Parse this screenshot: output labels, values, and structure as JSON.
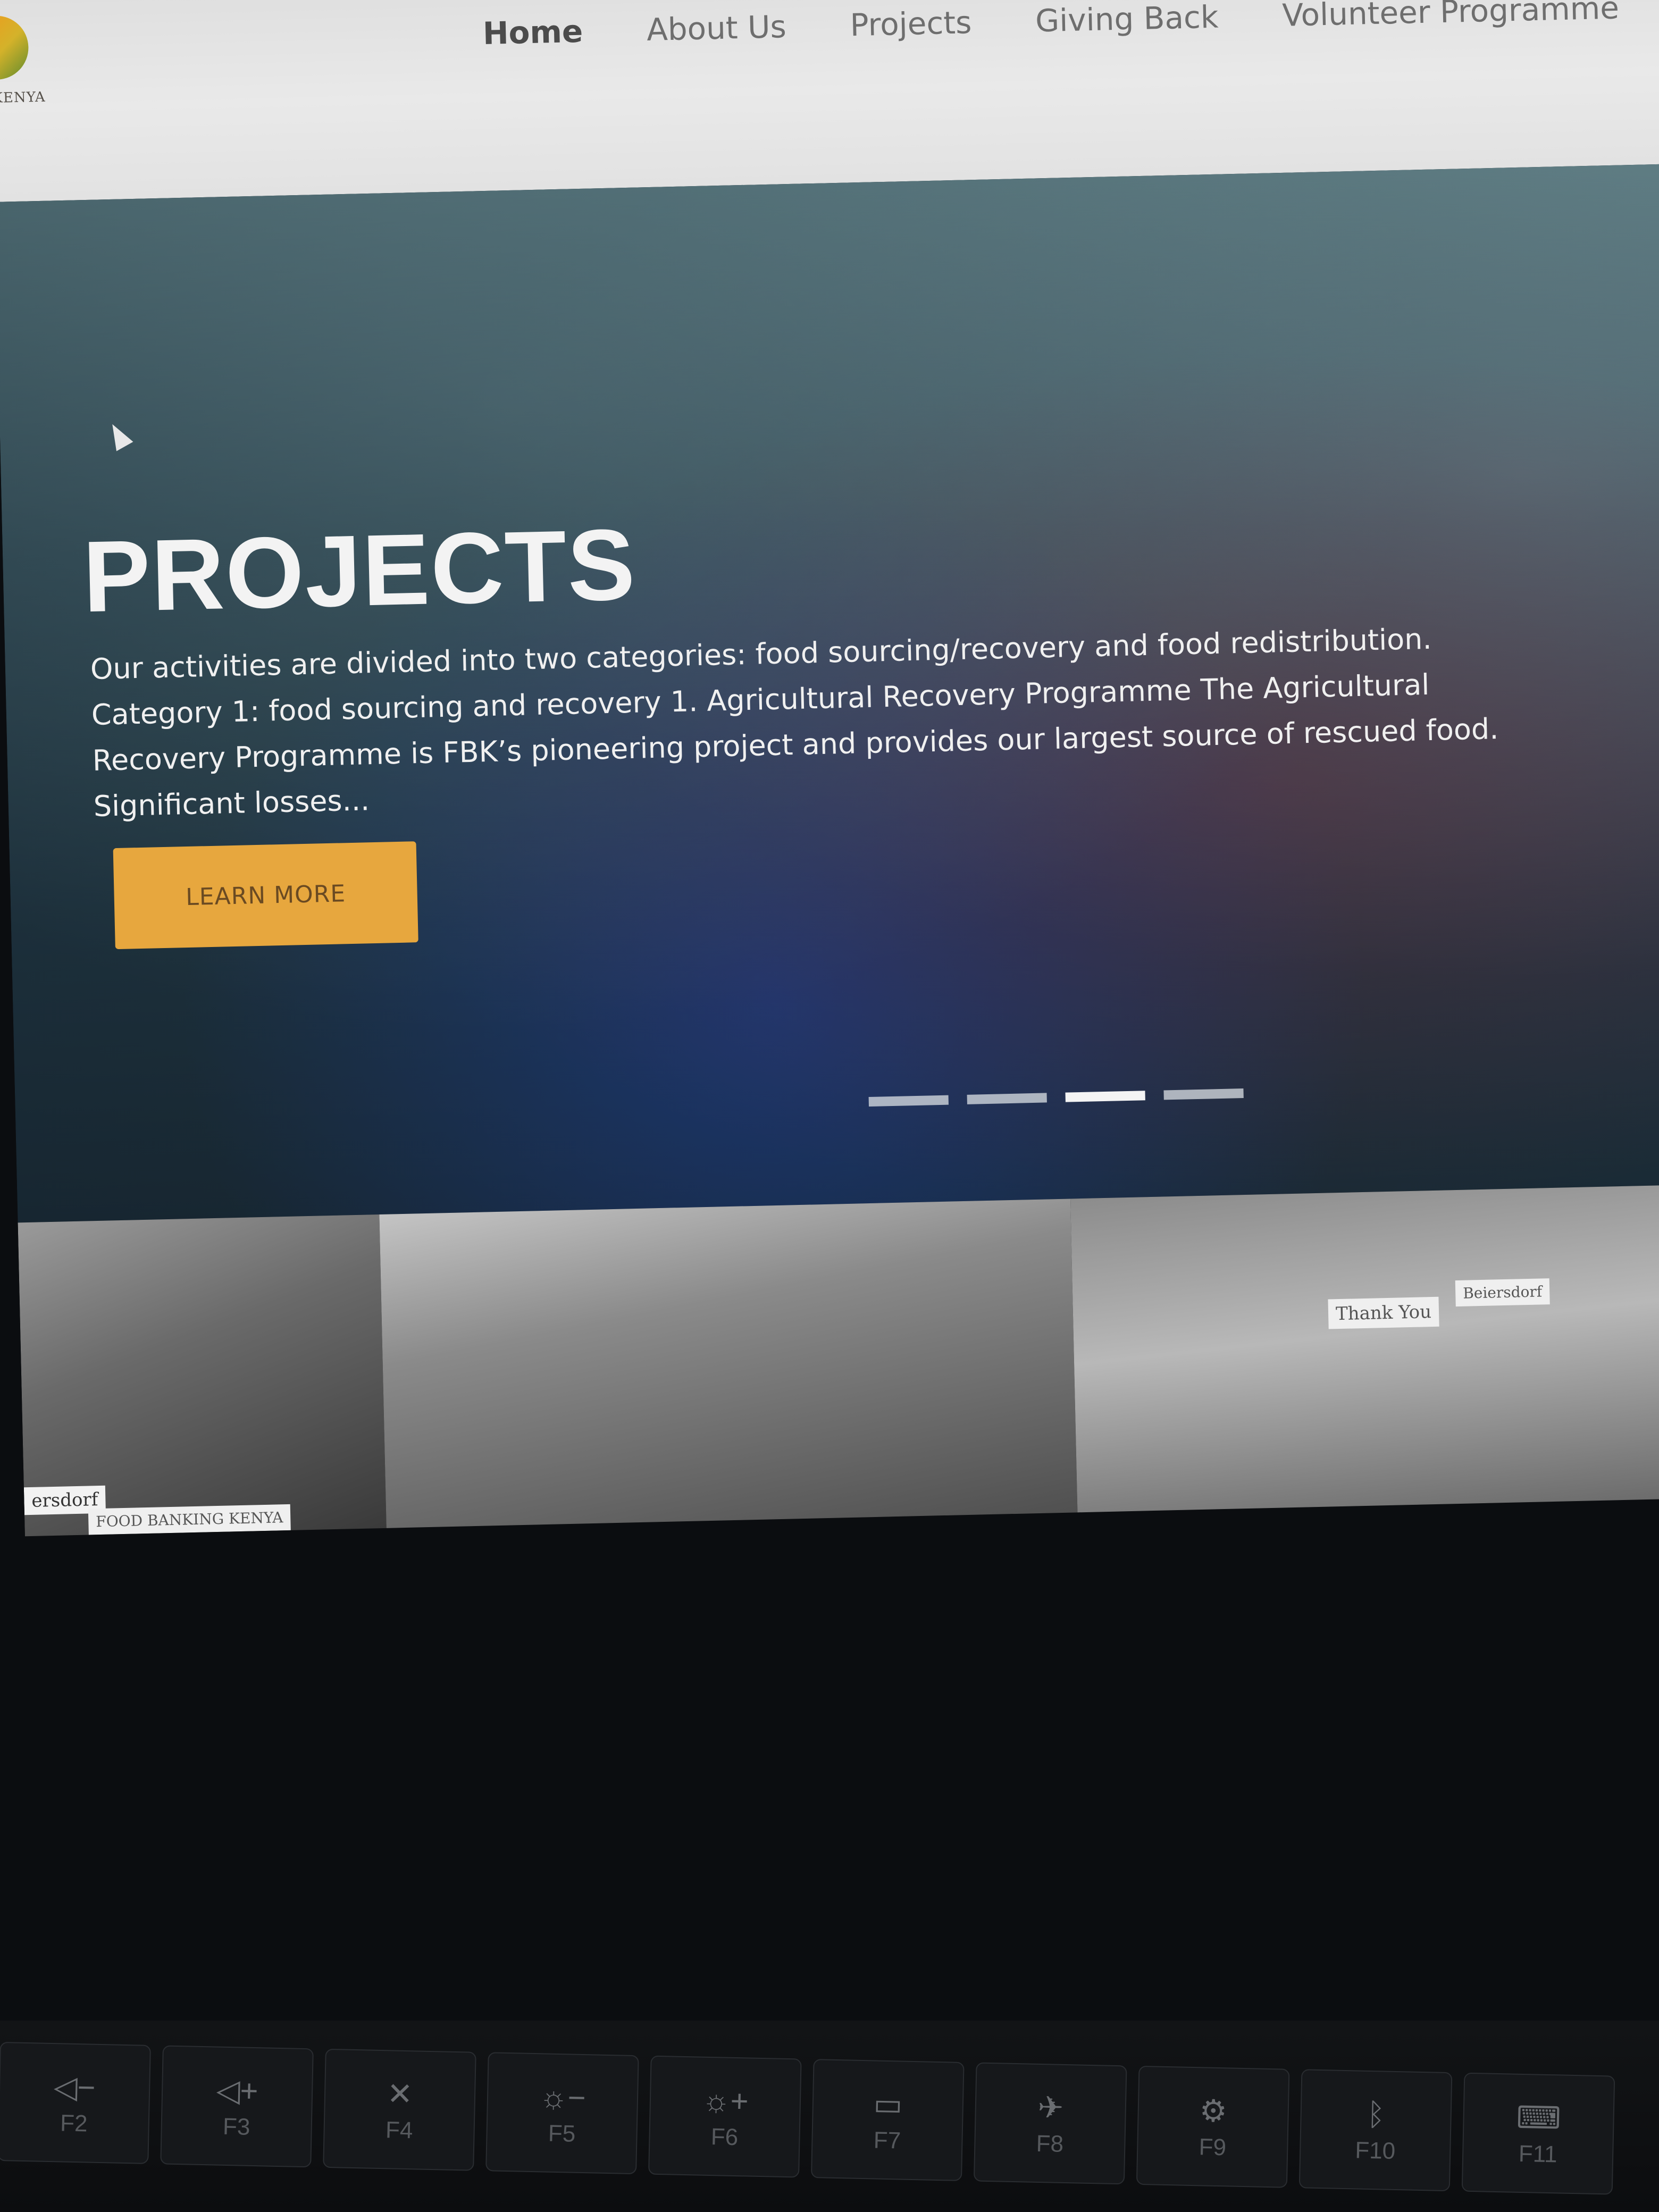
{
  "nav": {
    "logo_text": "KENYA",
    "items": [
      {
        "label": "Home",
        "active": true
      },
      {
        "label": "About Us"
      },
      {
        "label": "Projects"
      },
      {
        "label": "Giving Back"
      },
      {
        "label": "Volunteer Programme"
      }
    ]
  },
  "hero": {
    "title": "PROJECTS",
    "description": "Our activities are divided into two categories: food sourcing/recovery and food redistribution. Category 1: food sourcing and recovery 1. Agricultural Recovery Programme The Agricultural Recovery Programme is FBK’s pioneering project and provides our largest source of rescued food. Significant losses...",
    "button_label": "LEARN MORE",
    "slider": {
      "count": 4,
      "active_index": 2
    }
  },
  "gallery": {
    "caption_1": "ersdorf",
    "caption_1b": "FOOD BANKING KENYA",
    "sign_thank": "Thank You",
    "sign_name": "Beiersdorf"
  },
  "keyboard": {
    "keys": [
      {
        "label": "F2",
        "icon": "volume-down-icon",
        "glyph": "◁−"
      },
      {
        "label": "F3",
        "icon": "volume-up-icon",
        "glyph": "◁+"
      },
      {
        "label": "F4",
        "icon": "mic-mute-icon",
        "glyph": "✕"
      },
      {
        "label": "F5",
        "icon": "brightness-down-icon",
        "glyph": "☼−"
      },
      {
        "label": "F6",
        "icon": "brightness-up-icon",
        "glyph": "☼+"
      },
      {
        "label": "F7",
        "icon": "display-icon",
        "glyph": "▭"
      },
      {
        "label": "F8",
        "icon": "airplane-icon",
        "glyph": "✈"
      },
      {
        "label": "F9",
        "icon": "settings-icon",
        "glyph": "⚙"
      },
      {
        "label": "F10",
        "icon": "bluetooth-icon",
        "glyph": "ᛒ"
      },
      {
        "label": "F11",
        "icon": "keyboard-icon",
        "glyph": "⌨"
      }
    ]
  }
}
